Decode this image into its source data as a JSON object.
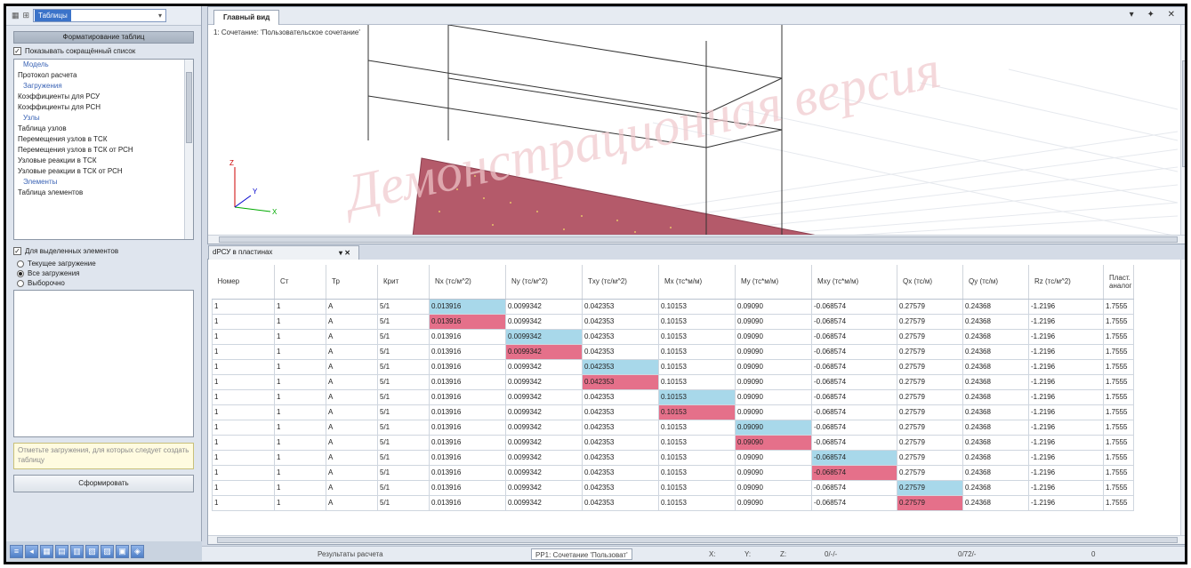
{
  "left_panel": {
    "selector_value": "Таблицы",
    "panel_title": "Форматирование таблиц",
    "show_short_list": "Показывать сокращённый список",
    "tree_items": [
      {
        "text": "Модель",
        "kind": "group"
      },
      {
        "text": "Протокол расчета",
        "kind": "item"
      },
      {
        "text": "Загружения",
        "kind": "group"
      },
      {
        "text": "Коэффициенты для РСУ",
        "kind": "item"
      },
      {
        "text": "Коэффициенты для РСН",
        "kind": "item"
      },
      {
        "text": "Узлы",
        "kind": "group"
      },
      {
        "text": "Таблица узлов",
        "kind": "item"
      },
      {
        "text": "Перемещения узлов в ТСК",
        "kind": "item"
      },
      {
        "text": "Перемещения узлов в ТСК от РСН",
        "kind": "item"
      },
      {
        "text": "Узловые реакции в ТСК",
        "kind": "item"
      },
      {
        "text": "Узловые реакции в ТСК от РСН",
        "kind": "item"
      },
      {
        "text": "Элементы",
        "kind": "group"
      },
      {
        "text": "Таблица элементов",
        "kind": "item"
      }
    ],
    "for_selected": "Для выделенных элементов",
    "radio_current": "Текущее загружение",
    "radio_all": "Все загружения",
    "radio_choice": "Выборочно",
    "hint": "Отметьте загружения, для которых следует создать таблицу",
    "format_button": "Сформировать"
  },
  "view": {
    "tab_title": "Главный вид",
    "caption": "1: Сочетание: 'Пользовательское сочетание'",
    "watermark": "Демонстрационная версия",
    "ctrl_icons": "▾ ✦ ✕",
    "axis_x": "X",
    "axis_y": "Y",
    "axis_z": "Z"
  },
  "table": {
    "tab_title": "dРСУ в пластинах",
    "tab_buttons": "▾ ✕",
    "columns": [
      "Номер",
      "Ст",
      "Тр",
      "Крит",
      "Nx (тс/м^2)",
      "Ny (тс/м^2)",
      "Txy (тс/м^2)",
      "Mx (тс*м/м)",
      "My (тс*м/м)",
      "Mxy (тс*м/м)",
      "Qx (тс/м)",
      "Qy (тс/м)",
      "Rz (тс/м^2)",
      "Пласт. аналог"
    ],
    "rows": [
      [
        "1",
        "1",
        "А",
        "5/1",
        "0.013916",
        "0.0099342",
        "0.042353",
        "0.10153",
        "0.09090",
        "-0.068574",
        "0.27579",
        "0.24368",
        "-1.2196",
        "1.7555"
      ],
      [
        "1",
        "1",
        "А",
        "5/1",
        "0.013916",
        "0.0099342",
        "0.042353",
        "0.10153",
        "0.09090",
        "-0.068574",
        "0.27579",
        "0.24368",
        "-1.2196",
        "1.7555"
      ],
      [
        "1",
        "1",
        "А",
        "5/1",
        "0.013916",
        "0.0099342",
        "0.042353",
        "0.10153",
        "0.09090",
        "-0.068574",
        "0.27579",
        "0.24368",
        "-1.2196",
        "1.7555"
      ],
      [
        "1",
        "1",
        "А",
        "5/1",
        "0.013916",
        "0.0099342",
        "0.042353",
        "0.10153",
        "0.09090",
        "-0.068574",
        "0.27579",
        "0.24368",
        "-1.2196",
        "1.7555"
      ],
      [
        "1",
        "1",
        "А",
        "5/1",
        "0.013916",
        "0.0099342",
        "0.042353",
        "0.10153",
        "0.09090",
        "-0.068574",
        "0.27579",
        "0.24368",
        "-1.2196",
        "1.7555"
      ],
      [
        "1",
        "1",
        "А",
        "5/1",
        "0.013916",
        "0.0099342",
        "0.042353",
        "0.10153",
        "0.09090",
        "-0.068574",
        "0.27579",
        "0.24368",
        "-1.2196",
        "1.7555"
      ],
      [
        "1",
        "1",
        "А",
        "5/1",
        "0.013916",
        "0.0099342",
        "0.042353",
        "0.10153",
        "0.09090",
        "-0.068574",
        "0.27579",
        "0.24368",
        "-1.2196",
        "1.7555"
      ],
      [
        "1",
        "1",
        "А",
        "5/1",
        "0.013916",
        "0.0099342",
        "0.042353",
        "0.10153",
        "0.09090",
        "-0.068574",
        "0.27579",
        "0.24368",
        "-1.2196",
        "1.7555"
      ],
      [
        "1",
        "1",
        "А",
        "5/1",
        "0.013916",
        "0.0099342",
        "0.042353",
        "0.10153",
        "0.09090",
        "-0.068574",
        "0.27579",
        "0.24368",
        "-1.2196",
        "1.7555"
      ],
      [
        "1",
        "1",
        "А",
        "5/1",
        "0.013916",
        "0.0099342",
        "0.042353",
        "0.10153",
        "0.09090",
        "-0.068574",
        "0.27579",
        "0.24368",
        "-1.2196",
        "1.7555"
      ],
      [
        "1",
        "1",
        "А",
        "5/1",
        "0.013916",
        "0.0099342",
        "0.042353",
        "0.10153",
        "0.09090",
        "-0.068574",
        "0.27579",
        "0.24368",
        "-1.2196",
        "1.7555"
      ],
      [
        "1",
        "1",
        "А",
        "5/1",
        "0.013916",
        "0.0099342",
        "0.042353",
        "0.10153",
        "0.09090",
        "-0.068574",
        "0.27579",
        "0.24368",
        "-1.2196",
        "1.7555"
      ],
      [
        "1",
        "1",
        "А",
        "5/1",
        "0.013916",
        "0.0099342",
        "0.042353",
        "0.10153",
        "0.09090",
        "-0.068574",
        "0.27579",
        "0.24368",
        "-1.2196",
        "1.7555"
      ],
      [
        "1",
        "1",
        "А",
        "5/1",
        "0.013916",
        "0.0099342",
        "0.042353",
        "0.10153",
        "0.09090",
        "-0.068574",
        "0.27579",
        "0.24368",
        "-1.2196",
        "1.7555"
      ]
    ],
    "highlights": [
      {
        "row": 0,
        "col": 4,
        "color": "blue"
      },
      {
        "row": 1,
        "col": 4,
        "color": "pink"
      },
      {
        "row": 2,
        "col": 5,
        "color": "blue"
      },
      {
        "row": 3,
        "col": 5,
        "color": "pink"
      },
      {
        "row": 4,
        "col": 6,
        "color": "blue"
      },
      {
        "row": 5,
        "col": 6,
        "color": "pink"
      },
      {
        "row": 6,
        "col": 7,
        "color": "blue"
      },
      {
        "row": 7,
        "col": 7,
        "color": "pink"
      },
      {
        "row": 8,
        "col": 8,
        "color": "blue"
      },
      {
        "row": 9,
        "col": 8,
        "color": "pink"
      },
      {
        "row": 10,
        "col": 9,
        "color": "blue"
      },
      {
        "row": 11,
        "col": 9,
        "color": "pink"
      },
      {
        "row": 12,
        "col": 10,
        "color": "blue"
      },
      {
        "row": 13,
        "col": 10,
        "color": "pink"
      }
    ]
  },
  "status_bar": {
    "results": "Результаты расчета",
    "combination": "РР1: Сочетание 'Пользоват'",
    "x": "X:",
    "y": "Y:",
    "z": "Z:",
    "count1": "0/-/-",
    "count2": "0/72/-",
    "count3": "0"
  },
  "colors": {
    "highlight_blue": "#a8d8ea",
    "highlight_pink": "#e5708a",
    "plate": "#b45a6a"
  }
}
